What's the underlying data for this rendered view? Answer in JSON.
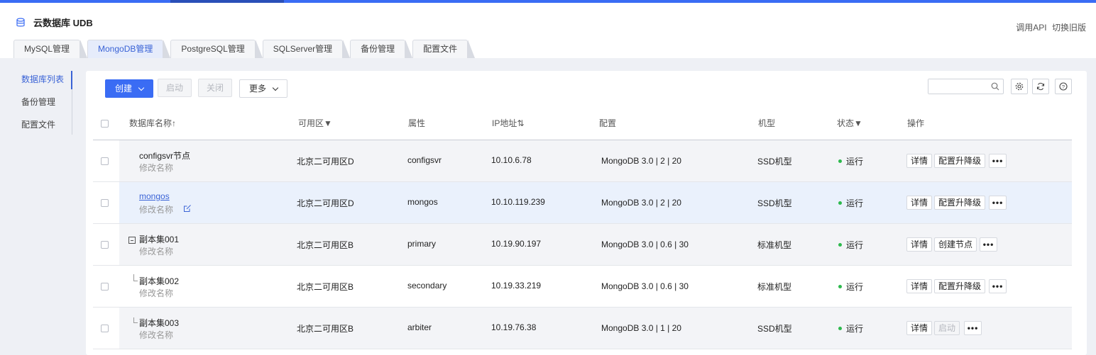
{
  "app": {
    "title": "云数据库 UDB",
    "links": [
      "调用API",
      "切换旧版"
    ]
  },
  "tabs": [
    {
      "label": "MySQL管理",
      "active": false
    },
    {
      "label": "MongoDB管理",
      "active": true
    },
    {
      "label": "PostgreSQL管理",
      "active": false
    },
    {
      "label": "SQLServer管理",
      "active": false
    },
    {
      "label": "备份管理",
      "active": false
    },
    {
      "label": "配置文件",
      "active": false
    }
  ],
  "sidebar": {
    "items": [
      {
        "label": "数据库列表",
        "active": true
      },
      {
        "label": "备份管理",
        "active": false
      },
      {
        "label": "配置文件",
        "active": false
      }
    ]
  },
  "toolbar": {
    "create": "创建",
    "start": "启动",
    "stop": "关闭",
    "more": "更多",
    "search_placeholder": ""
  },
  "icons": {
    "db": "database-icon",
    "search": "search-icon",
    "settings": "gear-icon",
    "refresh": "refresh-icon",
    "help": "help-icon"
  },
  "colors": {
    "accent": "#3a6cf4",
    "status_running": "#2db94d"
  },
  "table": {
    "headers": {
      "name": "数据库名称↑",
      "zone": "可用区▼",
      "attr": "属性",
      "ip": "IP地址⇅",
      "config": "配置",
      "model": "机型",
      "status": "状态▼",
      "ops": "操作"
    },
    "rows": [
      {
        "name": "configsvr节点",
        "sub": "修改名称",
        "zone": "北京二可用区D",
        "attr": "configsvr",
        "ip": "10.10.6.78",
        "config": "MongoDB 3.0 | 2 | 20",
        "model": "SSD机型",
        "status": "运行",
        "ops": [
          "详情",
          "配置升降级"
        ],
        "more": "•••"
      },
      {
        "name": "mongos",
        "sub": "修改名称",
        "zone": "北京二可用区D",
        "attr": "mongos",
        "ip": "10.10.119.239",
        "config": "MongoDB 3.0 | 2 | 20",
        "model": "SSD机型",
        "status": "运行",
        "ops": [
          "详情",
          "配置升降级"
        ],
        "more": "•••"
      },
      {
        "name": "副本集001",
        "sub": "修改名称",
        "zone": "北京二可用区B",
        "attr": "primary",
        "ip": "10.19.90.197",
        "config": "MongoDB 3.0 | 0.6 | 30",
        "model": "标准机型",
        "status": "运行",
        "ops": [
          "详情",
          "创建节点"
        ],
        "more": "•••"
      },
      {
        "name": "副本集002",
        "sub": "修改名称",
        "zone": "北京二可用区B",
        "attr": "secondary",
        "ip": "10.19.33.219",
        "config": "MongoDB 3.0 | 0.6 | 30",
        "model": "标准机型",
        "status": "运行",
        "ops": [
          "详情",
          "配置升降级"
        ],
        "more": "•••"
      },
      {
        "name": "副本集003",
        "sub": "修改名称",
        "zone": "北京二可用区B",
        "attr": "arbiter",
        "ip": "10.19.76.38",
        "config": "MongoDB 3.0 | 1 | 20",
        "model": "SSD机型",
        "status": "运行",
        "ops": [
          "详情",
          "启动"
        ],
        "more": "•••"
      }
    ]
  }
}
